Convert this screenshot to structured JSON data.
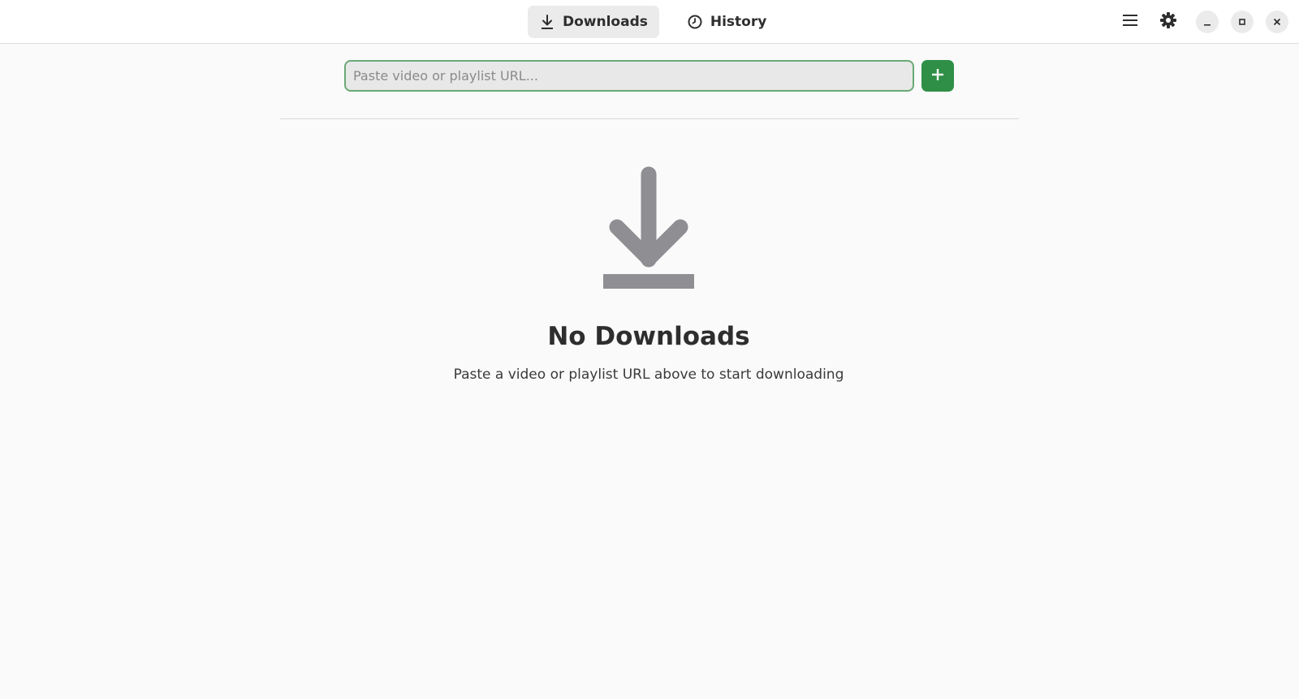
{
  "header": {
    "tabs": [
      {
        "label": "Downloads",
        "icon": "download-icon",
        "active": true
      },
      {
        "label": "History",
        "icon": "clock-icon",
        "active": false
      }
    ],
    "actions": [
      {
        "icon": "hamburger-menu-icon"
      },
      {
        "icon": "gear-icon"
      }
    ],
    "window_controls": [
      {
        "icon": "minimize-icon"
      },
      {
        "icon": "maximize-icon"
      },
      {
        "icon": "close-icon"
      }
    ]
  },
  "url_bar": {
    "placeholder": "Paste video or playlist URL...",
    "value": "",
    "add_button_icon": "plus-icon"
  },
  "empty_state": {
    "icon": "download-arrow-icon",
    "title": "No Downloads",
    "description": "Paste a video or playlist URL above to start downloading"
  },
  "colors": {
    "accent": "#2f8f46",
    "input_border": "#6aa976",
    "icon_gray": "#8e8e93"
  }
}
